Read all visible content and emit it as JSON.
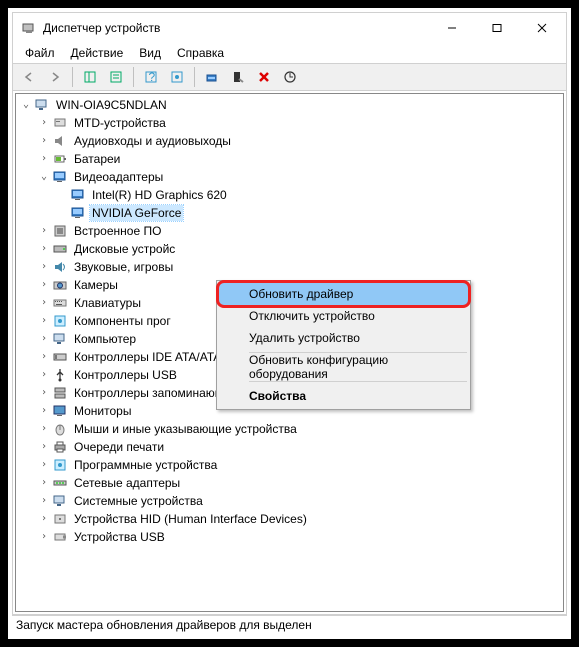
{
  "window": {
    "title": "Диспетчер устройств"
  },
  "menubar": {
    "file": "Файл",
    "action": "Действие",
    "view": "Вид",
    "help": "Справка"
  },
  "tree": {
    "root": "WIN-OIA9C5NDLAN",
    "items": [
      "MTD-устройства",
      "Аудиовходы и аудиовыходы",
      "Батареи",
      "Видеоадаптеры",
      "Встроенное ПО",
      "Дисковые устройс",
      "Звуковые, игровы",
      "Камеры",
      "Клавиатуры",
      "Компоненты прог",
      "Компьютер",
      "Контроллеры IDE ATA/ATAPI",
      "Контроллеры USB",
      "Контроллеры запоминающих устройств",
      "Мониторы",
      "Мыши и иные указывающие устройства",
      "Очереди печати",
      "Программные устройства",
      "Сетевые адаптеры",
      "Системные устройства",
      "Устройства HID (Human Interface Devices)",
      "Устройства USB"
    ],
    "video_children": [
      "Intel(R) HD Graphics 620",
      "NVIDIA GeForce"
    ]
  },
  "context_menu": {
    "update": "Обновить драйвер",
    "disable": "Отключить устройство",
    "remove": "Удалить устройство",
    "scan": "Обновить конфигурацию оборудования",
    "properties": "Свойства"
  },
  "statusbar": "Запуск мастера обновления драйверов для выделен"
}
